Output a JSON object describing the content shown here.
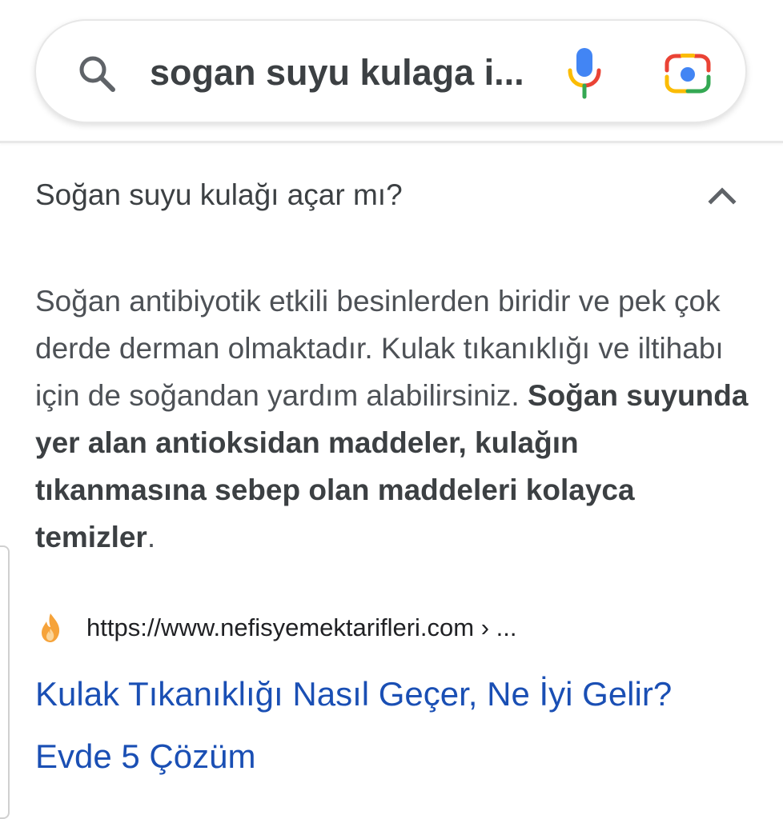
{
  "search": {
    "query": "sogan suyu kulaga i...",
    "icons": {
      "search": "search-icon",
      "voice": "microphone-icon",
      "lens": "camera-lens-icon"
    }
  },
  "faq": {
    "question": "Soğan suyu kulağı açar mı?",
    "expanded": true,
    "toggle_icon": "chevron-up-icon",
    "answer_plain": "Soğan antibiyotik etkili besinlerden biridir ve pek çok derde derman olmaktadır. Kulak tıkanıklığı ve iltihabı için de soğandan yardım alabilirsiniz. ",
    "answer_bold": "Soğan suyunda yer alan antioksidan maddeler, kulağın tıkanmasına sebep olan maddeleri kolayca temizler",
    "answer_end": "."
  },
  "result": {
    "favicon": "flame-favicon-icon",
    "url": "https://www.nefisyemektarifleri.com › ...",
    "title": "Kulak Tıkanıklığı Nasıl Geçer, Ne İyi Gelir? Evde 5 Çözüm"
  },
  "colors": {
    "link": "#1a4fb4",
    "text": "#3c4043",
    "google_blue": "#4285F4",
    "google_red": "#EA4335",
    "google_yellow": "#FBBC05",
    "google_green": "#34A853"
  }
}
